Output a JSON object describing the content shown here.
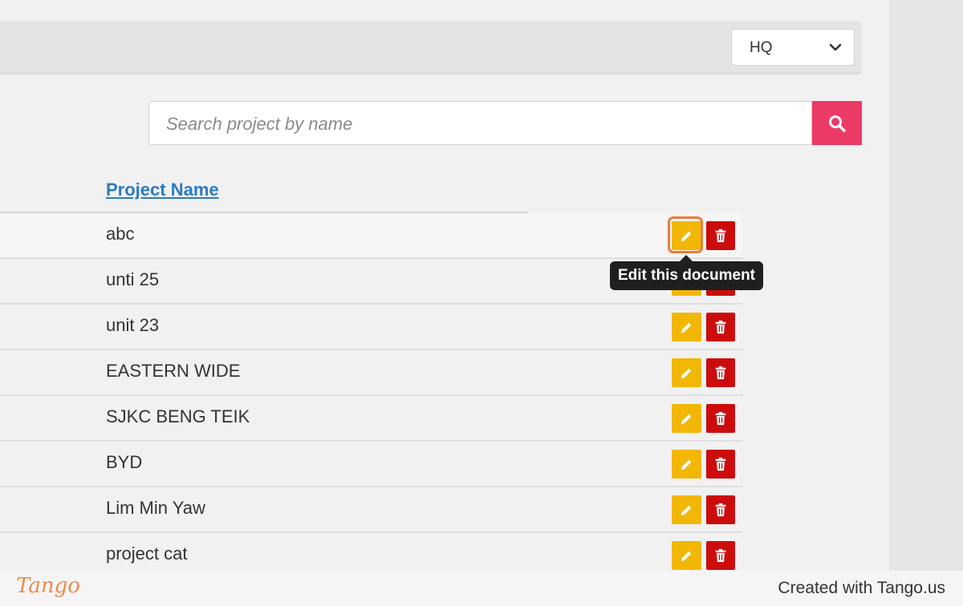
{
  "header": {
    "location_select": {
      "value": "HQ"
    }
  },
  "search": {
    "placeholder": "Search project by name"
  },
  "table": {
    "column_header": "Project Name",
    "rows": [
      {
        "name": "abc"
      },
      {
        "name": "unti 25"
      },
      {
        "name": "unit 23"
      },
      {
        "name": "EASTERN WIDE"
      },
      {
        "name": "SJKC BENG TEIK"
      },
      {
        "name": "BYD"
      },
      {
        "name": "Lim Min Yaw"
      },
      {
        "name": "project cat"
      }
    ]
  },
  "tooltip": {
    "text": "Edit this document"
  },
  "footer": {
    "logo": "Tango",
    "credit": "Created with Tango.us"
  },
  "icons": {
    "edit": "pencil-icon",
    "delete": "trash-icon",
    "search": "search-icon",
    "dropdown": "chevron-down-icon"
  },
  "colors": {
    "edit_button": "#f2b705",
    "delete_button": "#cc0c0c",
    "search_button": "#ec3a67",
    "link": "#2b7bc0",
    "highlight": "#f07a3c"
  }
}
